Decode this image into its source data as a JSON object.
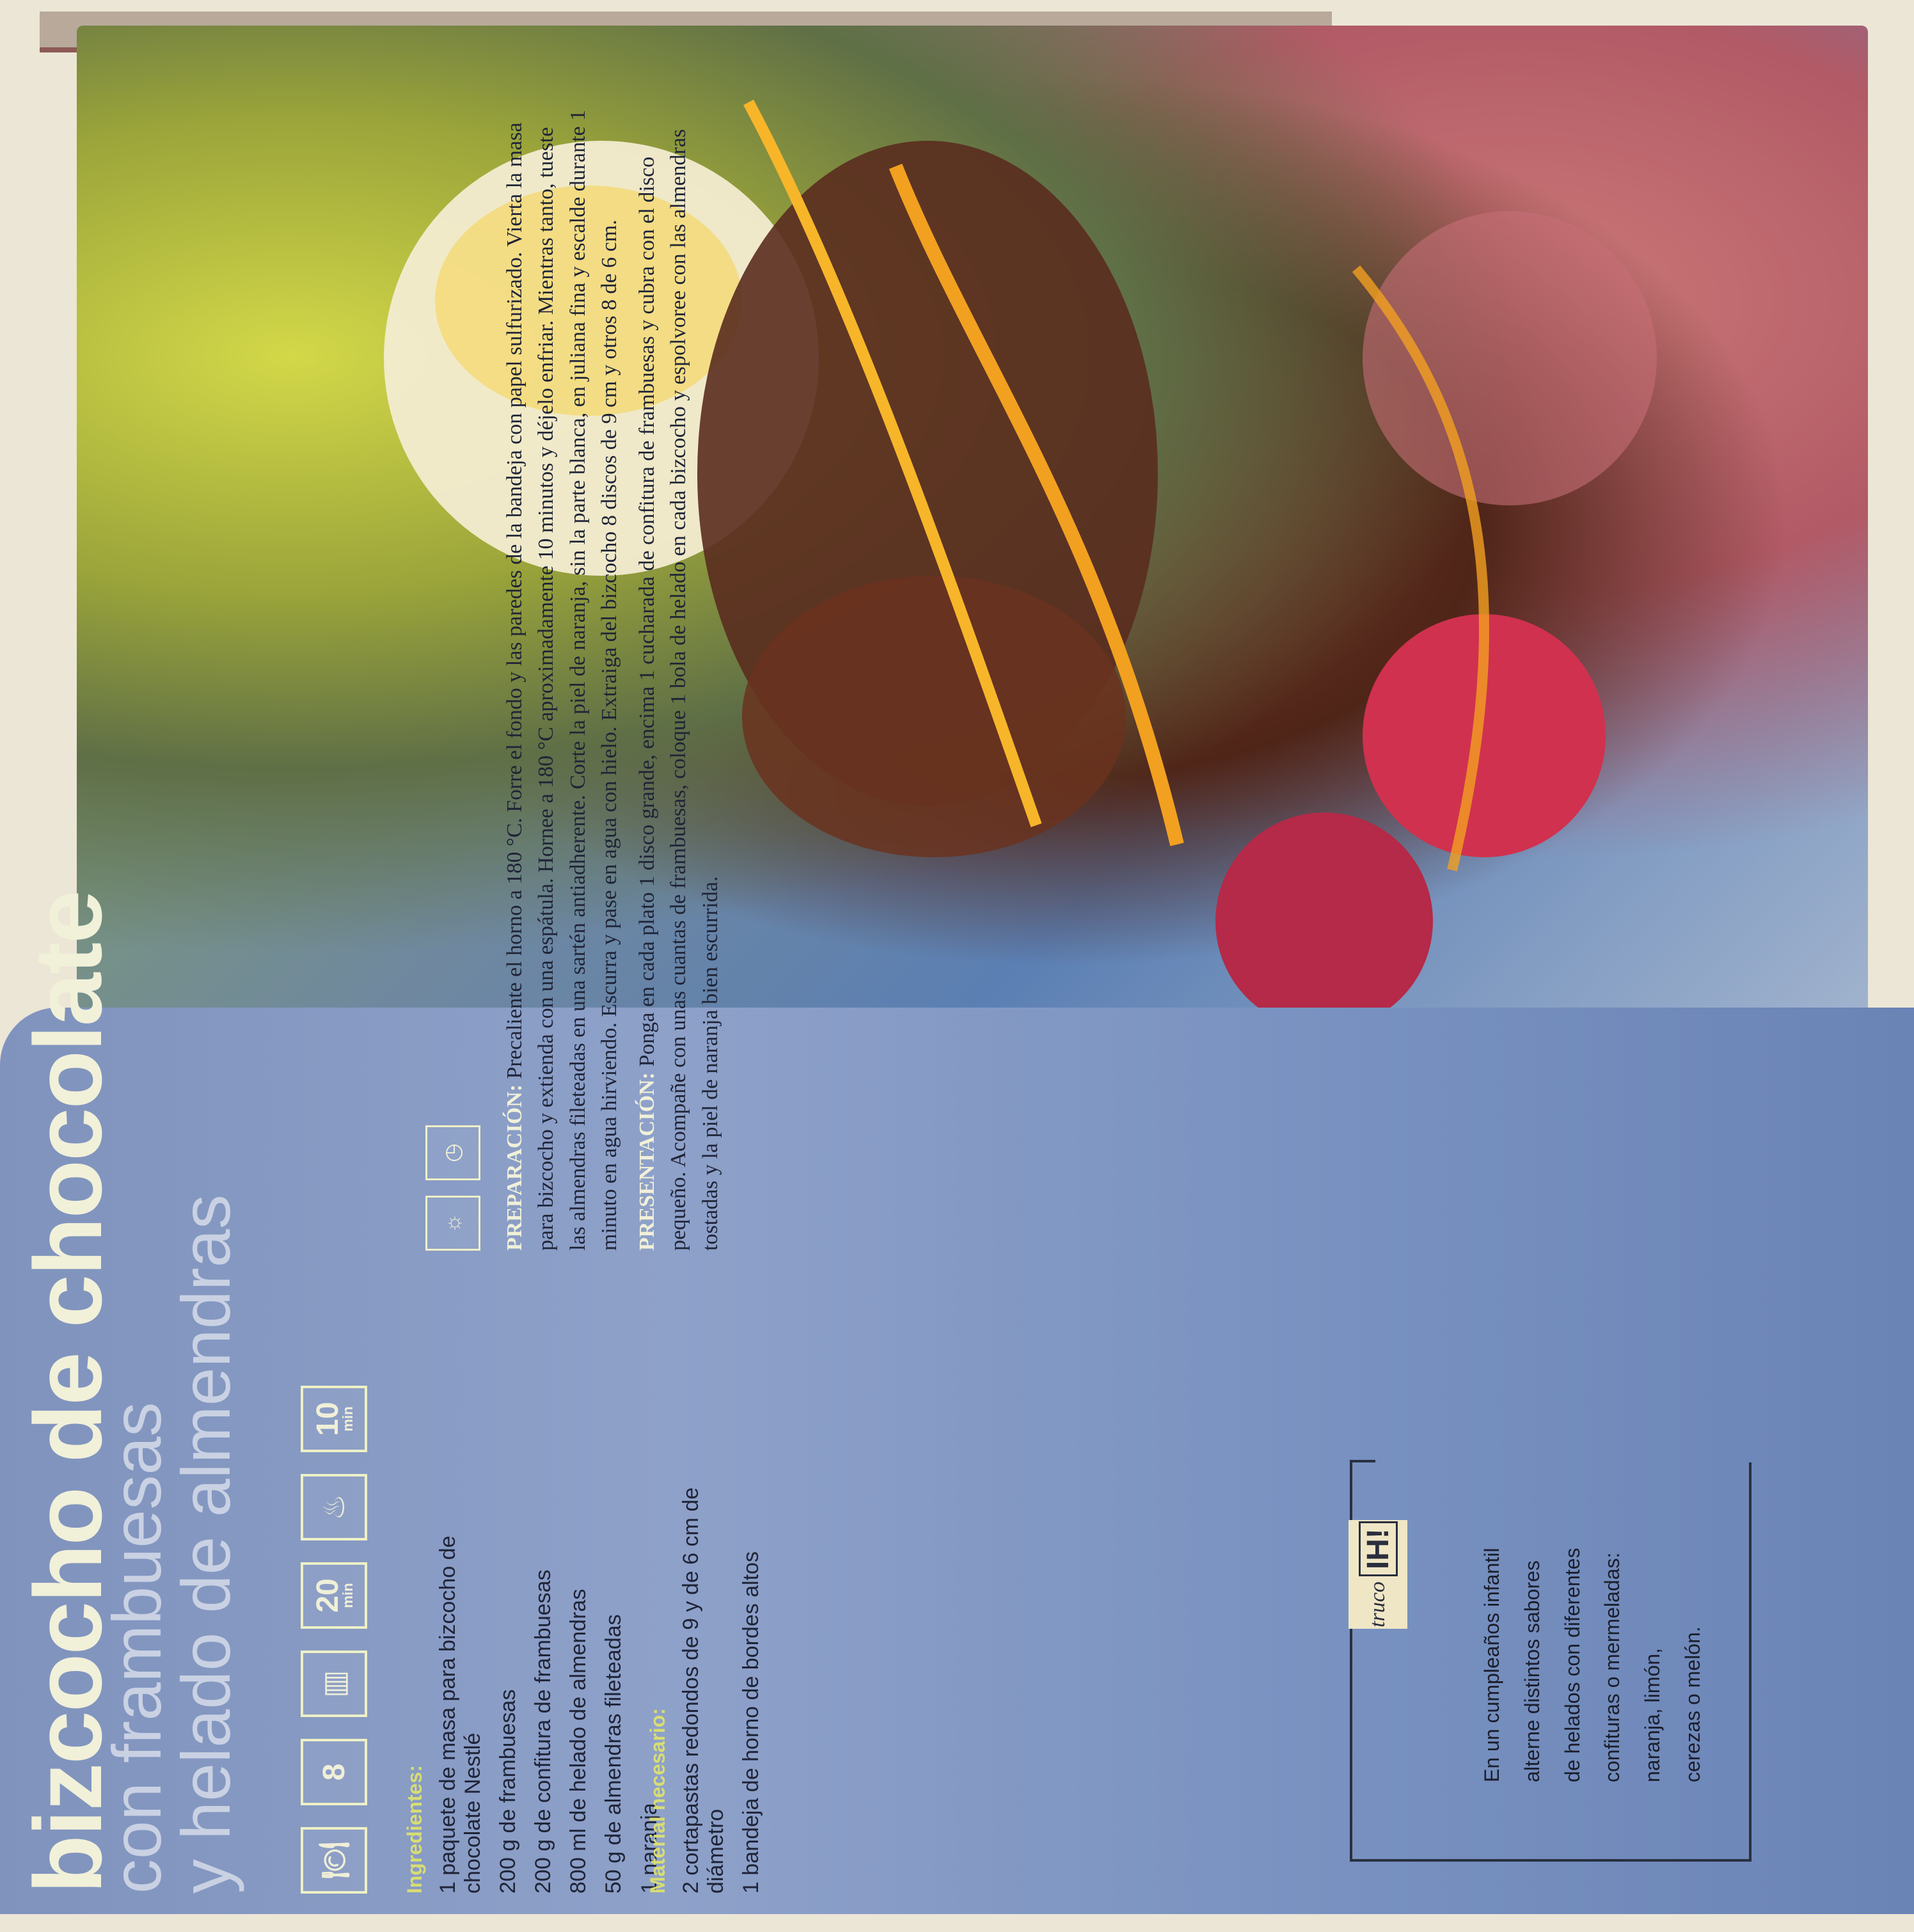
{
  "title": {
    "line1": "bizcocho de chocolate",
    "line2": "con frambuesas",
    "line3": "y helado de almendras"
  },
  "meta": {
    "servings": "8",
    "time1_value": "20",
    "time1_unit": "min",
    "time2_value": "10",
    "time2_unit": "min"
  },
  "icons": {
    "servings_icon": "plate-icon",
    "difficulty_icon": "glass-icon",
    "time_icon": "clock-icon",
    "oven_icon": "oven-icon",
    "temperature_icon": "sun-icon",
    "clock_icon": "timer-icon"
  },
  "ingredients": {
    "heading": "Ingredientes:",
    "items": [
      "1 paquete de masa para bizcocho de chocolate Nestlé",
      "200 g de frambuesas",
      "200 g de confitura de frambuesas",
      "800 ml de helado de almendras",
      "50 g de almendras fileteadas",
      "1 naranja"
    ]
  },
  "material": {
    "heading": "Material necesario:",
    "items": [
      "2 cortapastas redondos de 9 y de 6 cm de diámetro",
      "1 bandeja de horno de bordes altos"
    ]
  },
  "preparation": {
    "label": "PREPARACIÓN:",
    "text": "Precaliente el horno a 180 °C. Forre el fondo y las paredes de la bandeja con papel sulfurizado. Vierta la masa para bizcocho y extienda con una espátula. Hornee a 180 °C aproximadamente 10 minutos y déjelo enfriar. Mientras tanto, tueste las almendras fileteadas en una sartén antiadherente. Corte la piel de naranja, sin la parte blanca, en juliana fina y escalde durante 1 minuto en agua hirviendo. Escurra y pase en agua con hielo. Extraiga del bizcocho 8 discos de 9 cm y otros 8 de 6 cm.",
    "presentation_label": "PRESENTACIÓN:",
    "presentation_text": "Ponga en cada plato 1 disco grande, encima 1 cucharada de confitura de frambuesas y cubra con el disco pequeño. Acompañe con unas cuantas de frambuesas, coloque 1 bola de helado en cada bizcocho y espolvoree con las almendras tostadas y la piel de naranja bien escurrida."
  },
  "tip": {
    "badge_word": "truco",
    "badge_mark": "IH!",
    "lines": [
      "En un cumpleaños infantil",
      "alterne distintos sabores",
      "de helados con diferentes",
      "confituras o mermeladas:",
      "naranja, limón,",
      "cerezas o melón."
    ]
  },
  "colors": {
    "page_blue": "#8ea1c9",
    "title_cream": "#f1f0d9",
    "heading_yellow": "#d8dd73",
    "text_dark": "#1f2437"
  }
}
